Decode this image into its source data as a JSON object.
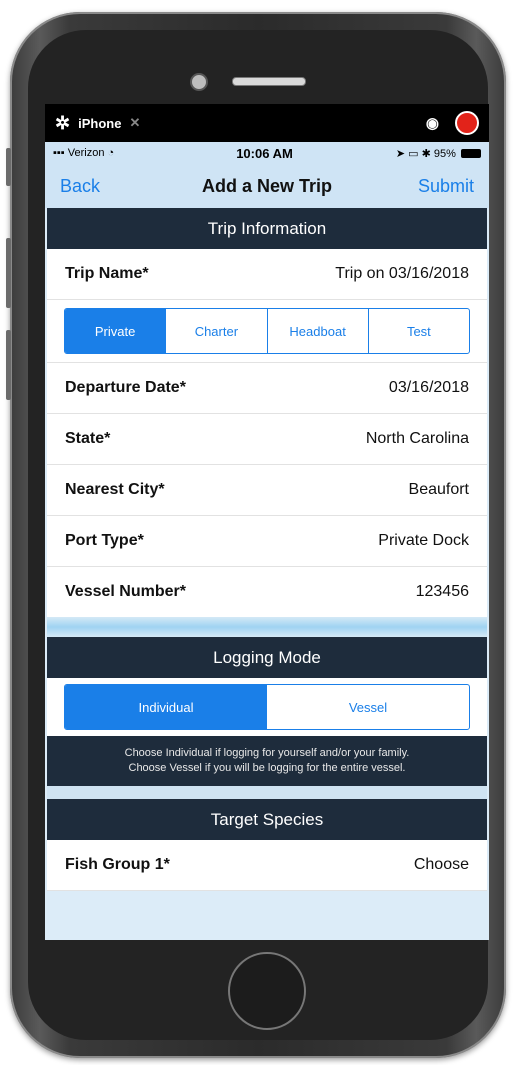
{
  "simulator": {
    "device_label": "iPhone",
    "close_glyph": "✕",
    "gear_icon": "gear-icon",
    "camera_icon": "camera-icon",
    "record_icon": "record-icon"
  },
  "status_bar": {
    "carrier": "Verizon",
    "time": "10:06 AM",
    "battery": "95%"
  },
  "nav": {
    "back_label": "Back",
    "title": "Add a New Trip",
    "submit_label": "Submit"
  },
  "trip_info": {
    "header": "Trip Information",
    "trip_name_label": "Trip Name*",
    "trip_name_value": "Trip on 03/16/2018",
    "trip_types": [
      "Private",
      "Charter",
      "Headboat",
      "Test"
    ],
    "selected_trip_type": "Private",
    "rows": [
      {
        "label": "Departure Date*",
        "value": "03/16/2018"
      },
      {
        "label": "State*",
        "value": "North Carolina"
      },
      {
        "label": "Nearest City*",
        "value": "Beaufort"
      },
      {
        "label": "Port Type*",
        "value": "Private Dock"
      },
      {
        "label": "Vessel Number*",
        "value": "123456"
      }
    ]
  },
  "logging_mode": {
    "header": "Logging Mode",
    "options": [
      "Individual",
      "Vessel"
    ],
    "selected": "Individual",
    "info_line1": "Choose Individual if logging for yourself and/or your family.",
    "info_line2": "Choose Vessel if you will be logging for the entire vessel."
  },
  "target_species": {
    "header": "Target Species",
    "fish_group_label": "Fish Group 1*",
    "fish_group_value": "Choose"
  },
  "colors": {
    "accent": "#1a7fe8",
    "section_header": "#1e2c3c",
    "record": "#e2231a"
  }
}
